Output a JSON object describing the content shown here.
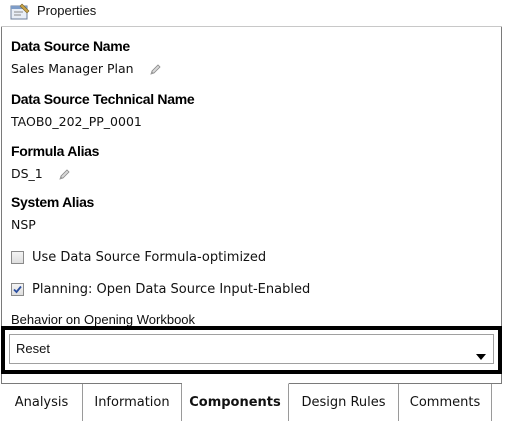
{
  "panel": {
    "title": "Properties"
  },
  "fields": {
    "data_source_name": {
      "label": "Data Source Name",
      "value": "Sales Manager Plan"
    },
    "technical_name": {
      "label": "Data Source Technical Name",
      "value": "TAOB0_202_PP_0001"
    },
    "formula_alias": {
      "label": "Formula Alias",
      "value": "DS_1"
    },
    "system_alias": {
      "label": "System Alias",
      "value": "NSP"
    }
  },
  "checkboxes": [
    {
      "label": "Use Data Source Formula-optimized",
      "checked": false
    },
    {
      "label": "Planning: Open Data Source Input-Enabled",
      "checked": true
    }
  ],
  "behavior": {
    "label": "Behavior on Opening Workbook",
    "selected": "Reset"
  },
  "tabs": [
    {
      "label": "Analysis",
      "active": false
    },
    {
      "label": "Information",
      "active": false
    },
    {
      "label": "Components",
      "active": true
    },
    {
      "label": "Design Rules",
      "active": false
    },
    {
      "label": "Comments",
      "active": false
    }
  ],
  "colors": {
    "highlight_border": "#000000",
    "checkbox_check": "#2b4fa0"
  }
}
